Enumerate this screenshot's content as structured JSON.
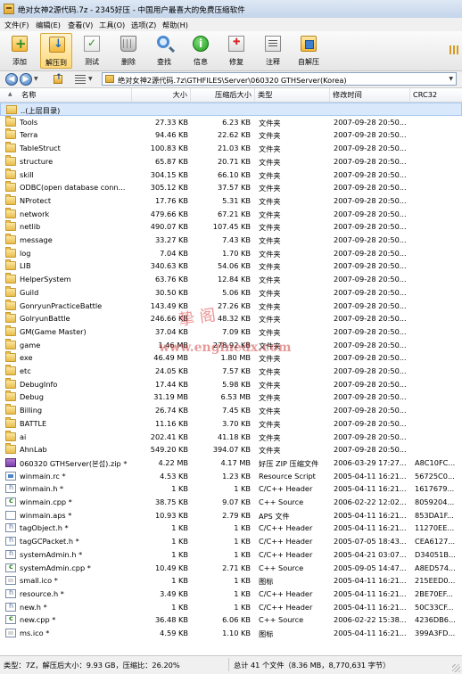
{
  "window": {
    "title": "绝对女神2源代码.7z - 2345好压 - 中国用户最喜大的免费压缩软件"
  },
  "menu": [
    "文件(F)",
    "编辑(E)",
    "查看(V)",
    "工具(O)",
    "选项(Z)",
    "帮助(H)"
  ],
  "toolbar": [
    {
      "label": "添加",
      "icon": "add-archive-icon"
    },
    {
      "label": "解压到",
      "icon": "extract-icon"
    },
    {
      "label": "测试",
      "icon": "test-icon"
    },
    {
      "label": "删除",
      "icon": "delete-icon"
    },
    {
      "label": "查找",
      "icon": "find-icon"
    },
    {
      "label": "信息",
      "icon": "info-icon"
    },
    {
      "label": "修复",
      "icon": "repair-icon"
    },
    {
      "label": "注释",
      "icon": "comment-icon"
    },
    {
      "label": "自解压",
      "icon": "sfx-icon"
    }
  ],
  "address": {
    "path": "绝对女神2源代码.7z\\GTHFILES\\Server\\060320 GTHServer(Korea)"
  },
  "columns": {
    "name": "名称",
    "size": "大小",
    "packed": "压缩后大小",
    "type": "类型",
    "modified": "修改时间",
    "crc": "CRC32"
  },
  "rows": [
    {
      "name": "..(上层目录)",
      "size": "",
      "packed": "",
      "type": "",
      "modified": "",
      "crc": "",
      "icon": "up"
    },
    {
      "name": "Tools",
      "size": "27.33 KB",
      "packed": "6.23 KB",
      "type": "文件夹",
      "modified": "2007-09-28 20:50...",
      "crc": "",
      "icon": "folder"
    },
    {
      "name": "Terra",
      "size": "94.46 KB",
      "packed": "22.62 KB",
      "type": "文件夹",
      "modified": "2007-09-28 20:50...",
      "crc": "",
      "icon": "folder"
    },
    {
      "name": "TableStruct",
      "size": "100.83 KB",
      "packed": "21.03 KB",
      "type": "文件夹",
      "modified": "2007-09-28 20:50...",
      "crc": "",
      "icon": "folder"
    },
    {
      "name": "structure",
      "size": "65.87 KB",
      "packed": "20.71 KB",
      "type": "文件夹",
      "modified": "2007-09-28 20:50...",
      "crc": "",
      "icon": "folder"
    },
    {
      "name": "skill",
      "size": "304.15 KB",
      "packed": "66.10 KB",
      "type": "文件夹",
      "modified": "2007-09-28 20:50...",
      "crc": "",
      "icon": "folder"
    },
    {
      "name": "ODBC(open database conn...",
      "size": "305.12 KB",
      "packed": "37.57 KB",
      "type": "文件夹",
      "modified": "2007-09-28 20:50...",
      "crc": "",
      "icon": "folder"
    },
    {
      "name": "NProtect",
      "size": "17.76 KB",
      "packed": "5.31 KB",
      "type": "文件夹",
      "modified": "2007-09-28 20:50...",
      "crc": "",
      "icon": "folder"
    },
    {
      "name": "network",
      "size": "479.66 KB",
      "packed": "67.21 KB",
      "type": "文件夹",
      "modified": "2007-09-28 20:50...",
      "crc": "",
      "icon": "folder"
    },
    {
      "name": "netlib",
      "size": "490.07 KB",
      "packed": "107.45 KB",
      "type": "文件夹",
      "modified": "2007-09-28 20:50...",
      "crc": "",
      "icon": "folder"
    },
    {
      "name": "message",
      "size": "33.27 KB",
      "packed": "7.43 KB",
      "type": "文件夹",
      "modified": "2007-09-28 20:50...",
      "crc": "",
      "icon": "folder"
    },
    {
      "name": "log",
      "size": "7.04 KB",
      "packed": "1.70 KB",
      "type": "文件夹",
      "modified": "2007-09-28 20:50...",
      "crc": "",
      "icon": "folder"
    },
    {
      "name": "LIB",
      "size": "340.63 KB",
      "packed": "54.06 KB",
      "type": "文件夹",
      "modified": "2007-09-28 20:50...",
      "crc": "",
      "icon": "folder"
    },
    {
      "name": "HelperSystem",
      "size": "63.76 KB",
      "packed": "12.84 KB",
      "type": "文件夹",
      "modified": "2007-09-28 20:50...",
      "crc": "",
      "icon": "folder"
    },
    {
      "name": "Guild",
      "size": "30.50 KB",
      "packed": "5.06 KB",
      "type": "文件夹",
      "modified": "2007-09-28 20:50...",
      "crc": "",
      "icon": "folder"
    },
    {
      "name": "GonryunPracticeBattle",
      "size": "143.49 KB",
      "packed": "27.26 KB",
      "type": "文件夹",
      "modified": "2007-09-28 20:50...",
      "crc": "",
      "icon": "folder"
    },
    {
      "name": "GolryunBattle",
      "size": "246.66 KB",
      "packed": "48.32 KB",
      "type": "文件夹",
      "modified": "2007-09-28 20:50...",
      "crc": "",
      "icon": "folder"
    },
    {
      "name": "GM(Game Master)",
      "size": "37.04 KB",
      "packed": "7.09 KB",
      "type": "文件夹",
      "modified": "2007-09-28 20:50...",
      "crc": "",
      "icon": "folder"
    },
    {
      "name": "game",
      "size": "1.46 MB",
      "packed": "278.92 KB",
      "type": "文件夹",
      "modified": "2007-09-28 20:50...",
      "crc": "",
      "icon": "folder"
    },
    {
      "name": "exe",
      "size": "46.49 MB",
      "packed": "1.80 MB",
      "type": "文件夹",
      "modified": "2007-09-28 20:50...",
      "crc": "",
      "icon": "folder"
    },
    {
      "name": "etc",
      "size": "24.05 KB",
      "packed": "7.57 KB",
      "type": "文件夹",
      "modified": "2007-09-28 20:50...",
      "crc": "",
      "icon": "folder"
    },
    {
      "name": "DebugInfo",
      "size": "17.44 KB",
      "packed": "5.98 KB",
      "type": "文件夹",
      "modified": "2007-09-28 20:50...",
      "crc": "",
      "icon": "folder"
    },
    {
      "name": "Debug",
      "size": "31.19 MB",
      "packed": "6.53 MB",
      "type": "文件夹",
      "modified": "2007-09-28 20:50...",
      "crc": "",
      "icon": "folder"
    },
    {
      "name": "Billing",
      "size": "26.74 KB",
      "packed": "7.45 KB",
      "type": "文件夹",
      "modified": "2007-09-28 20:50...",
      "crc": "",
      "icon": "folder"
    },
    {
      "name": "BATTLE",
      "size": "11.16 KB",
      "packed": "3.70 KB",
      "type": "文件夹",
      "modified": "2007-09-28 20:50...",
      "crc": "",
      "icon": "folder"
    },
    {
      "name": "ai",
      "size": "202.41 KB",
      "packed": "41.18 KB",
      "type": "文件夹",
      "modified": "2007-09-28 20:50...",
      "crc": "",
      "icon": "folder"
    },
    {
      "name": "AhnLab",
      "size": "549.20 KB",
      "packed": "394.07 KB",
      "type": "文件夹",
      "modified": "2007-09-28 20:50...",
      "crc": "",
      "icon": "folder"
    },
    {
      "name": "060320 GTHServer(본섭).zip *",
      "size": "4.22 MB",
      "packed": "4.17 MB",
      "type": "好压 ZIP 压缩文件",
      "modified": "2006-03-29 17:27...",
      "crc": "A8C10FC...",
      "icon": "zip"
    },
    {
      "name": "winmain.rc *",
      "size": "4.53 KB",
      "packed": "1.23 KB",
      "type": "Resource Script",
      "modified": "2005-04-11 16:21...",
      "crc": "56725C0...",
      "icon": "rc"
    },
    {
      "name": "winmain.h *",
      "size": "1 KB",
      "packed": "1 KB",
      "type": "C/C++ Header",
      "modified": "2005-04-11 16:21...",
      "crc": "1617679...",
      "icon": "h"
    },
    {
      "name": "winmain.cpp *",
      "size": "38.75 KB",
      "packed": "9.07 KB",
      "type": "C++ Source",
      "modified": "2006-02-22 12:02...",
      "crc": "8059204...",
      "icon": "cpp"
    },
    {
      "name": "winmain.aps *",
      "size": "10.93 KB",
      "packed": "2.79 KB",
      "type": "APS 文件",
      "modified": "2005-04-11 16:21...",
      "crc": "853DA1F...",
      "icon": "aps"
    },
    {
      "name": "tagObject.h *",
      "size": "1 KB",
      "packed": "1 KB",
      "type": "C/C++ Header",
      "modified": "2005-04-11 16:21...",
      "crc": "11270EE...",
      "icon": "h"
    },
    {
      "name": "tagGCPacket.h *",
      "size": "1 KB",
      "packed": "1 KB",
      "type": "C/C++ Header",
      "modified": "2005-07-05 18:43...",
      "crc": "CEA6127...",
      "icon": "h"
    },
    {
      "name": "systemAdmin.h *",
      "size": "1 KB",
      "packed": "1 KB",
      "type": "C/C++ Header",
      "modified": "2005-04-21 03:07...",
      "crc": "D34051B...",
      "icon": "h"
    },
    {
      "name": "systemAdmin.cpp *",
      "size": "10.49 KB",
      "packed": "2.71 KB",
      "type": "C++ Source",
      "modified": "2005-09-05 14:47...",
      "crc": "A8ED574...",
      "icon": "cpp"
    },
    {
      "name": "small.ico *",
      "size": "1 KB",
      "packed": "1 KB",
      "type": "图标",
      "modified": "2005-04-11 16:21...",
      "crc": "215EED0...",
      "icon": "ico"
    },
    {
      "name": "resource.h *",
      "size": "3.49 KB",
      "packed": "1 KB",
      "type": "C/C++ Header",
      "modified": "2005-04-11 16:21...",
      "crc": "2BE70EF...",
      "icon": "h"
    },
    {
      "name": "new.h *",
      "size": "1 KB",
      "packed": "1 KB",
      "type": "C/C++ Header",
      "modified": "2005-04-11 16:21...",
      "crc": "50C33CF...",
      "icon": "h"
    },
    {
      "name": "new.cpp *",
      "size": "36.48 KB",
      "packed": "6.06 KB",
      "type": "C++ Source",
      "modified": "2006-02-22 15:38...",
      "crc": "4236DB6...",
      "icon": "cpp"
    },
    {
      "name": "ms.ico *",
      "size": "4.59 KB",
      "packed": "1.10 KB",
      "type": "图标",
      "modified": "2005-04-11 16:21...",
      "crc": "399A3FD...",
      "icon": "ico"
    }
  ],
  "status": {
    "left": "类型：7Z，解压后大小：9.93 GB，压缩比：26.20%",
    "right": "总计 41 个文件（8.36 MB，8,770,631 字节）"
  },
  "watermark": {
    "line1": "挚    阁",
    "line2": "www.enginedx.com"
  }
}
